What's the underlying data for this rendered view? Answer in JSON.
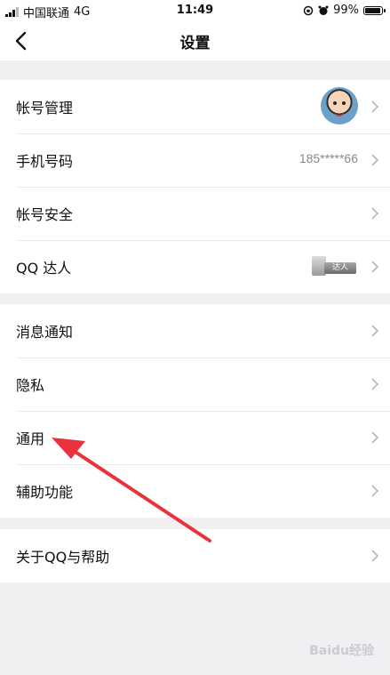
{
  "status_bar": {
    "carrier": "中国联通",
    "network": "4G",
    "time": "11:49",
    "battery": "99%",
    "battery_level": 0.99
  },
  "header": {
    "title": "设置"
  },
  "groups": [
    {
      "items": [
        {
          "label": "帐号管理"
        },
        {
          "label": "手机号码",
          "value": "185*****66"
        },
        {
          "label": "帐号安全"
        },
        {
          "label": "QQ 达人",
          "badge": "达人"
        }
      ]
    },
    {
      "items": [
        {
          "label": "消息通知"
        },
        {
          "label": "隐私"
        },
        {
          "label": "通用"
        },
        {
          "label": "辅助功能"
        }
      ]
    },
    {
      "items": [
        {
          "label": "关于QQ与帮助"
        }
      ]
    }
  ],
  "annotation": {
    "color": "#e8323c"
  },
  "watermark": "Baidu经验"
}
